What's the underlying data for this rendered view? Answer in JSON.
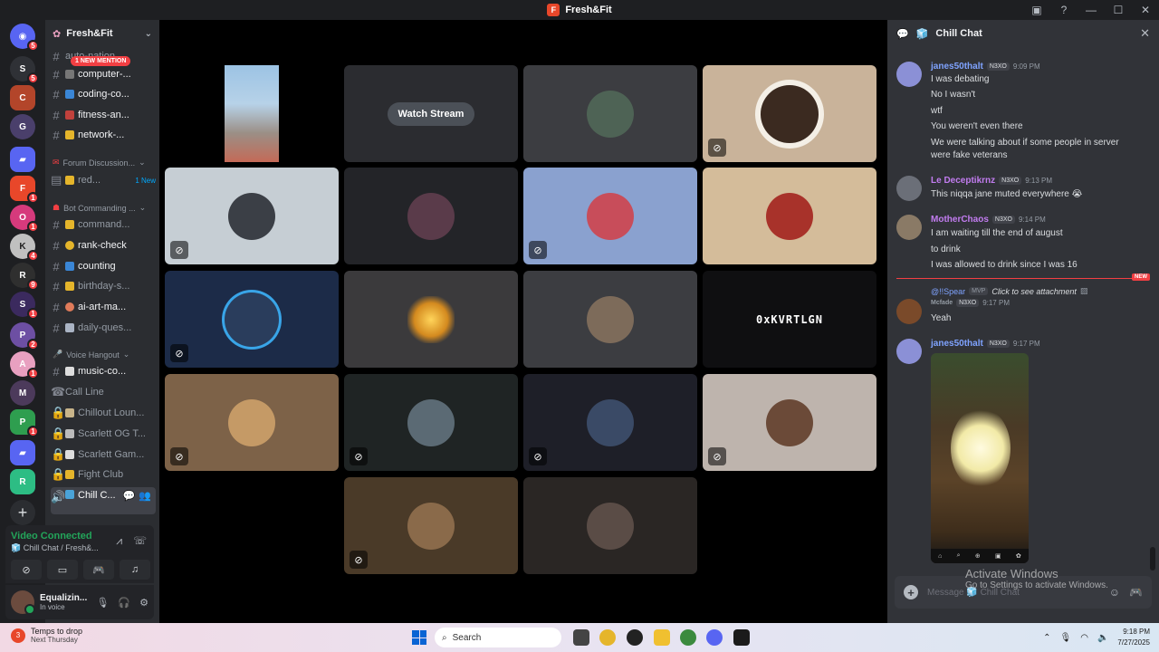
{
  "window": {
    "title": "Fresh&Fit"
  },
  "server_rail": {
    "badges": [
      "5",
      "5",
      "1",
      "1",
      "4",
      "9",
      "1",
      "2",
      "1",
      "1"
    ]
  },
  "sidebar": {
    "guild_name": "Fresh&Fit",
    "mention_pill": "1 NEW MENTION",
    "channels": [
      {
        "label": "auto-nation"
      },
      {
        "label": "computer-..."
      },
      {
        "label": "coding-co..."
      },
      {
        "label": "fitness-an..."
      },
      {
        "label": "network-..."
      }
    ],
    "forum_category": "Forum Discussion...",
    "forum_channel": {
      "label": "red...",
      "tag": "1 New"
    },
    "bot_category": "Bot Commanding ...",
    "bot_channels": [
      {
        "label": "command..."
      },
      {
        "label": "rank-check"
      },
      {
        "label": "counting"
      },
      {
        "label": "birthday-s..."
      },
      {
        "label": "ai-art-ma..."
      },
      {
        "label": "daily-ques..."
      }
    ],
    "voice_category": "Voice Hangout",
    "voice_channels": [
      {
        "label": "music-co..."
      },
      {
        "label": "Call Line"
      },
      {
        "label": "Chillout Loun..."
      },
      {
        "label": "Scarlett OG T..."
      },
      {
        "label": "Scarlett Gam..."
      },
      {
        "label": "Fight Club"
      },
      {
        "label": "Chill C..."
      }
    ]
  },
  "voice_panel": {
    "status": "Video Connected",
    "channel": "Chill Chat / Fresh&..."
  },
  "user_panel": {
    "name": "Equalizin...",
    "sub": "In voice"
  },
  "stage": {
    "watch_stream": "Watch Stream",
    "tile_text": "0xKVRTLGN"
  },
  "chat": {
    "title": "Chill Chat",
    "messages": [
      {
        "author": "janes50thalt",
        "tag": "N3XO",
        "time": "9:09 PM",
        "lines": [
          "I was debating",
          "No I wasn't",
          "wtf",
          "You weren't even there",
          "We were talking about if some people in server",
          "were fake veterans"
        ]
      },
      {
        "author": "Le Deceptikrnz",
        "tag": "N3XO",
        "time": "9:13 PM",
        "lines": [
          "This niqqa jane muted everywhere 😭"
        ]
      },
      {
        "author": "MotherChaos",
        "tag": "N3XO",
        "time": "9:14 PM",
        "lines": [
          "I am waiting till the end of august",
          "to drink",
          "I was allowed to drink since I was 16"
        ]
      },
      {
        "reply_author": "@!!Spear",
        "reply_tag": "MVP",
        "reply_text": "Click to see attachment",
        "author": "Mcfade",
        "tag": "N3XO",
        "time": "9:17 PM",
        "lines": [
          "Yeah"
        ]
      },
      {
        "author": "janes50thalt",
        "tag": "N3XO",
        "time": "9:17 PM",
        "lines": []
      }
    ],
    "new_tag": "NEW",
    "composer_placeholder": "Message 🧊 Chill Chat",
    "activate_title": "Activate Windows",
    "activate_sub": "Go to Settings to activate Windows."
  },
  "taskbar": {
    "weather_badge": "3",
    "weather_line1": "Temps to drop",
    "weather_line2": "Next Thursday",
    "search_label": "Search",
    "time": "9:18 PM",
    "date": "7/27/2025"
  },
  "colors": {
    "accent": "#5865f2",
    "danger": "#f23f43",
    "online": "#23a55a",
    "name_blue": "#7fa3ff",
    "name_purple": "#c27cf0"
  }
}
